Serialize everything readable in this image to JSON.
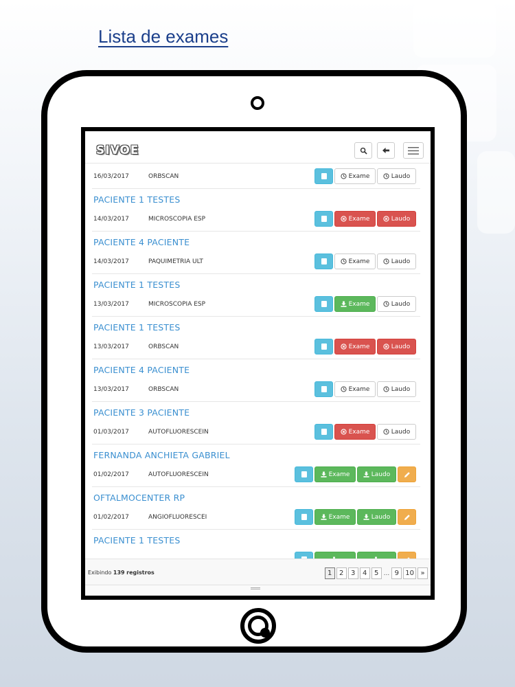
{
  "page_title": "Lista de exames",
  "app": {
    "logo": "SIVOE"
  },
  "icons": {
    "search": "search-icon",
    "back": "arrow-left-icon",
    "menu": "hamburger-menu-icon",
    "document": "document-icon",
    "clock": "clock-icon",
    "cancel": "times-circle-icon",
    "download": "download-icon",
    "edit": "pencil-icon"
  },
  "colors": {
    "info": "#5bc0de",
    "success": "#5cb85c",
    "danger": "#d9534f",
    "warning": "#f0ad4e",
    "patient_name": "#3a8fd0",
    "page_title": "#1b3f8b"
  },
  "records": [
    {
      "patient": "",
      "date": "16/03/2017",
      "exam": "ORBSCAN",
      "exam_btn": "Exame",
      "laudo_btn": "Laudo",
      "exam_state": "pending",
      "laudo_state": "pending",
      "edit": false
    },
    {
      "patient": "PACIENTE 1 TESTES",
      "date": "14/03/2017",
      "exam": "MICROSCOPIA ESP",
      "exam_btn": "Exame",
      "laudo_btn": "Laudo",
      "exam_state": "cancelled",
      "laudo_state": "cancelled",
      "edit": false
    },
    {
      "patient": "PACIENTE 4 PACIENTE",
      "date": "14/03/2017",
      "exam": "PAQUIMETRIA ULT",
      "exam_btn": "Exame",
      "laudo_btn": "Laudo",
      "exam_state": "pending",
      "laudo_state": "pending",
      "edit": false
    },
    {
      "patient": "PACIENTE 1 TESTES",
      "date": "13/03/2017",
      "exam": "MICROSCOPIA ESP",
      "exam_btn": "Exame",
      "laudo_btn": "Laudo",
      "exam_state": "available",
      "laudo_state": "pending",
      "edit": false
    },
    {
      "patient": "PACIENTE 1 TESTES",
      "date": "13/03/2017",
      "exam": "ORBSCAN",
      "exam_btn": "Exame",
      "laudo_btn": "Laudo",
      "exam_state": "cancelled",
      "laudo_state": "cancelled",
      "edit": false
    },
    {
      "patient": "PACIENTE 4 PACIENTE",
      "date": "13/03/2017",
      "exam": "ORBSCAN",
      "exam_btn": "Exame",
      "laudo_btn": "Laudo",
      "exam_state": "pending",
      "laudo_state": "pending",
      "edit": false
    },
    {
      "patient": "PACIENTE 3 PACIENTE",
      "date": "01/03/2017",
      "exam": "AUTOFLUORESCEIN",
      "exam_btn": "Exame",
      "laudo_btn": "Laudo",
      "exam_state": "cancelled",
      "laudo_state": "pending",
      "edit": false
    },
    {
      "patient": "FERNANDA ANCHIETA GABRIEL",
      "date": "01/02/2017",
      "exam": "AUTOFLUORESCEIN",
      "exam_btn": "Exame",
      "laudo_btn": "Laudo",
      "exam_state": "available",
      "laudo_state": "available",
      "edit": true
    },
    {
      "patient": "OFTALMOCENTER RP",
      "date": "01/02/2017",
      "exam": "ANGIOFLUORESCEI",
      "exam_btn": "Exame",
      "laudo_btn": "Laudo",
      "exam_state": "available",
      "laudo_state": "available",
      "edit": true
    },
    {
      "patient": "PACIENTE 1 TESTES",
      "date": "",
      "exam": "",
      "exam_btn": "",
      "laudo_btn": "",
      "exam_state": "available",
      "laudo_state": "available",
      "edit": true
    }
  ],
  "footer": {
    "prefix": "Exibindo",
    "count": "139",
    "suffix": "registros",
    "pages": [
      "1",
      "2",
      "3",
      "4",
      "5"
    ],
    "ellipsis": "...",
    "pages_end": [
      "9",
      "10"
    ],
    "next": "»",
    "current_page": "1"
  }
}
